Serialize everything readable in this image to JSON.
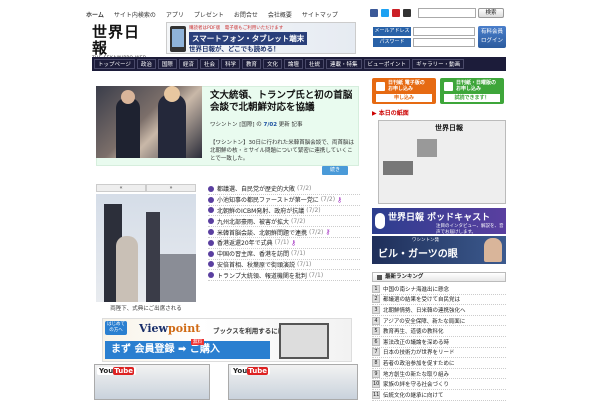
{
  "toplinks": [
    "ホーム",
    "サイト内検索の",
    "アプリ",
    "プレゼント",
    "お問合せ",
    "会社概要",
    "サイトマップ"
  ],
  "header": {
    "search_button": "検索",
    "logo_main": "世界日報",
    "logo_sub": "THE SEKAINIPPO WEB"
  },
  "banner": {
    "top": "購読者はPDF版　電子版もご利用いただけます",
    "main": "スマートフォン・タブレット端末",
    "sub": "世界日報が、どこでも読める！"
  },
  "login": {
    "email_label": "メールアドレス",
    "pass_label": "パスワード",
    "button_line1": "有料会員",
    "button_line2": "ログイン"
  },
  "nav": [
    "トップページ",
    "政治",
    "国際",
    "経済",
    "社会",
    "科学",
    "教育",
    "文化",
    "論壇",
    "社説",
    "連載・特集",
    "ビューポイント",
    "ギャラリー・動画"
  ],
  "feature": {
    "title": "文大統領、トランプ氏と初の首脳会談で北朝鮮対応を協議",
    "meta_prefix": "ワシントン [国際] の",
    "meta_date": "7/02",
    "meta_suffix": "更新 記事",
    "body": "【ワシントン】30日に行われた米韓首脳会談で、両首脳は北朝鮮の核・ミサイル問題について緊密に連携していくことで一致した。",
    "more": "続き"
  },
  "gallery": {
    "prev": "«",
    "next": "»",
    "caption": "両陛下、式典にご出席される"
  },
  "news": [
    {
      "title": "都議選、自民党が歴史的大敗",
      "date": "(7/2)",
      "key": false
    },
    {
      "title": "小池知事の都民ファーストが第一党に",
      "date": "(7/2)",
      "key": true
    },
    {
      "title": "北朝鮮のICBM発射、政府が抗議",
      "date": "(7/2)",
      "key": false
    },
    {
      "title": "九州北部豪雨、被害が拡大",
      "date": "(7/2)",
      "key": false
    },
    {
      "title": "米韓首脳会談、北朝鮮問題で連携",
      "date": "(7/2)",
      "key": true
    },
    {
      "title": "香港返還20年で式典",
      "date": "(7/1)",
      "key": true
    },
    {
      "title": "中国の習主席、香港を訪問",
      "date": "(7/1)",
      "key": false
    },
    {
      "title": "安倍首相、秋葉原で街頭演説",
      "date": "(7/1)",
      "key": false
    },
    {
      "title": "トランプ大統領、報道機関を批判",
      "date": "(7/1)",
      "key": false
    }
  ],
  "viewpoint_ad": {
    "tag": "はじめての方へ",
    "brand_a": "View",
    "brand_b": "point",
    "brand_rest": "ブックスを利用するには",
    "cta": "まず 会員登録 ➡ ご購入",
    "new": "無料"
  },
  "youtube": {
    "logo_a": "You",
    "logo_b": "Tube"
  },
  "right": {
    "box1_line1": "日刊紙 電子版の",
    "box1_line2": "お申し込み",
    "box1_btn": "申し込み",
    "box2_line1": "日刊紙・日曜版の",
    "box2_line2": "お申し込み",
    "box2_btn": "試読できます！",
    "sec1": "▶ 本日の紙面",
    "paper_head": "世界日報",
    "podcast_title": "世界日報 ポッドキャスト",
    "podcast_sub": "注目のインタビュー、解説を、音声でお届けします。",
    "gates_top": "ワシントン発",
    "gates_title": "ビル・ガーツの眼",
    "list_head": "最新ランキング",
    "ranking": [
      "中国の南シナ海進出に懸念",
      "都議選の結果を受けて自民党は",
      "北朝鮮情勢、日米韓の連携強化へ",
      "アジアの安全保障、新たな局面に",
      "教育再生、道徳の教科化",
      "憲法改正の議論を深める時",
      "日本の技術力が世界をリード",
      "若者の政治参加を促すために",
      "地方創生の新たな取り組み",
      "家族の絆を守る社会づくり",
      "伝統文化の継承に向けて"
    ]
  },
  "colors": {
    "nav_bg": "#1c1c3a",
    "feature_bg": "#e9fbef",
    "orange": "#e66a12",
    "green": "#3ea63a",
    "accent_blue": "#2962a8"
  }
}
